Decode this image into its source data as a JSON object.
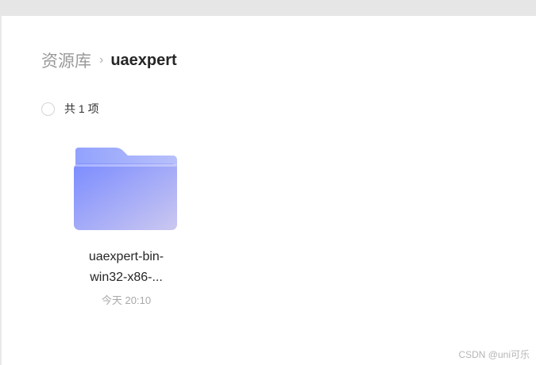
{
  "breadcrumb": {
    "root": "资源库",
    "separator": "›",
    "current": "uaexpert"
  },
  "summary": {
    "count_text": "共 1 项"
  },
  "files": [
    {
      "name_line1": "uaexpert-bin-",
      "name_line2": "win32-x86-...",
      "time": "今天 20:10",
      "icon": "folder-icon"
    }
  ],
  "watermark": "CSDN @uni可乐",
  "colors": {
    "folder_front_start": "#7b8cff",
    "folder_front_end": "#c9c6f2",
    "folder_back": "#9aa8fb",
    "topbar": "#e6e6e6"
  }
}
